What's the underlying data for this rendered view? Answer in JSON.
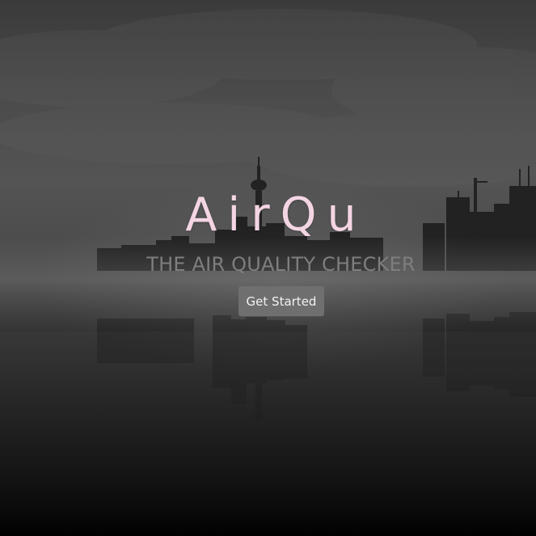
{
  "hero": {
    "logo": "AirQu",
    "tagline": "THE AIR QUALITY CHECKER",
    "cta_label": "Get Started"
  },
  "colors": {
    "logo": "#f4d5e3",
    "tagline": "#7e7e7e",
    "button_bg": "#6f6f6f",
    "button_text": "#f2f2f2"
  },
  "background": {
    "scene": "city-skyline-fog-icon"
  }
}
